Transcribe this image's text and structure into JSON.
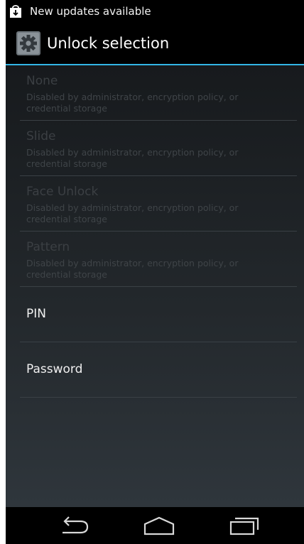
{
  "status_bar": {
    "notification_text": "New updates available",
    "notification_icon": "shopping-bag-download-icon"
  },
  "action_bar": {
    "title": "Unlock selection",
    "icon": "settings-gear-icon",
    "accent_color": "#33b5e5"
  },
  "options": [
    {
      "title": "None",
      "summary": "Disabled by administrator, encryption policy, or credential storage",
      "enabled": false
    },
    {
      "title": "Slide",
      "summary": "Disabled by administrator, encryption policy, or credential storage",
      "enabled": false
    },
    {
      "title": "Face Unlock",
      "summary": "Disabled by administrator, encryption policy, or credential storage",
      "enabled": false
    },
    {
      "title": "Pattern",
      "summary": "Disabled by administrator, encryption policy, or credential storage",
      "enabled": false
    },
    {
      "title": "PIN",
      "summary": "",
      "enabled": true
    },
    {
      "title": "Password",
      "summary": "",
      "enabled": true
    }
  ],
  "nav_bar": {
    "back_icon": "back-arrow-icon",
    "home_icon": "home-icon",
    "recents_icon": "recent-apps-icon"
  }
}
